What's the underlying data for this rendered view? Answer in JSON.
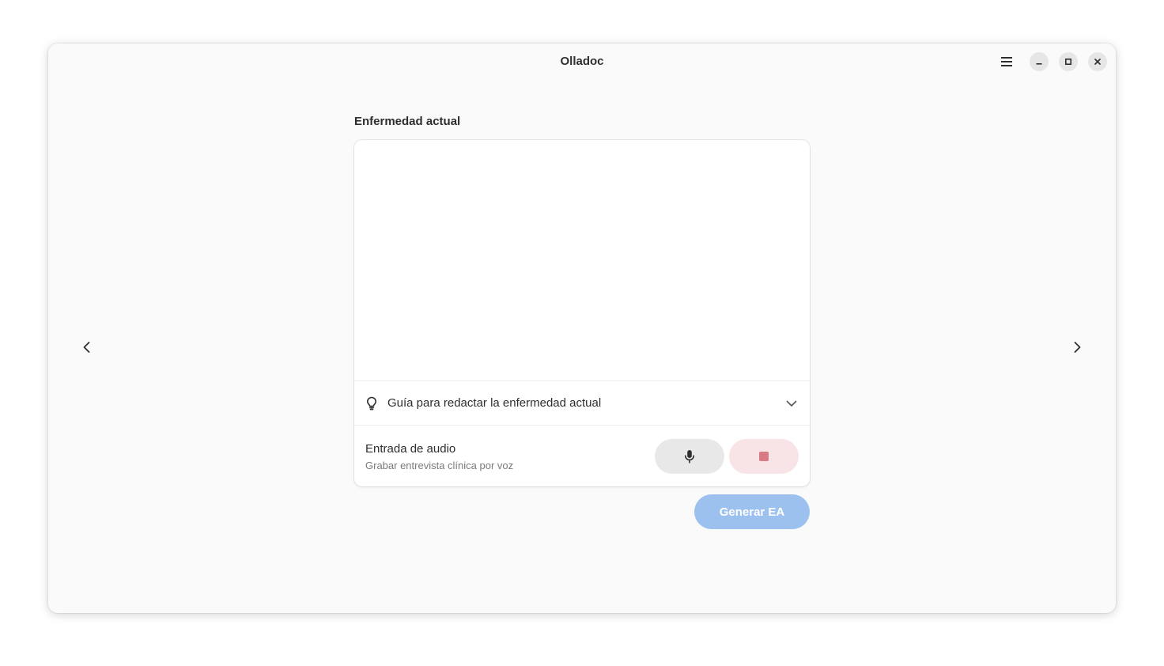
{
  "window": {
    "title": "Olladoc"
  },
  "headerbar": {
    "menu_icon": "hamburger-menu-icon",
    "controls": [
      "minimize-icon",
      "maximize-icon",
      "close-icon"
    ]
  },
  "navigation": {
    "prev_icon": "chevron-left-icon",
    "next_icon": "chevron-right-icon"
  },
  "section": {
    "title": "Enfermedad actual",
    "text_value": ""
  },
  "guide": {
    "icon": "lightbulb-icon",
    "label": "Guía para redactar la enfermedad actual",
    "expander_icon": "chevron-down-icon"
  },
  "audio": {
    "title": "Entrada de audio",
    "subtitle": "Grabar entrevista clínica por voz",
    "record_icon": "microphone-icon",
    "stop_icon": "stop-icon"
  },
  "actions": {
    "generate_label": "Generar EA"
  },
  "colors": {
    "window_bg": "#fafafa",
    "card_bg": "#ffffff",
    "generate_bg": "#9dc1ef",
    "stop_bg": "#f8e4e6",
    "stop_icon": "#d87a84",
    "mic_bg": "#e8e8e8"
  }
}
